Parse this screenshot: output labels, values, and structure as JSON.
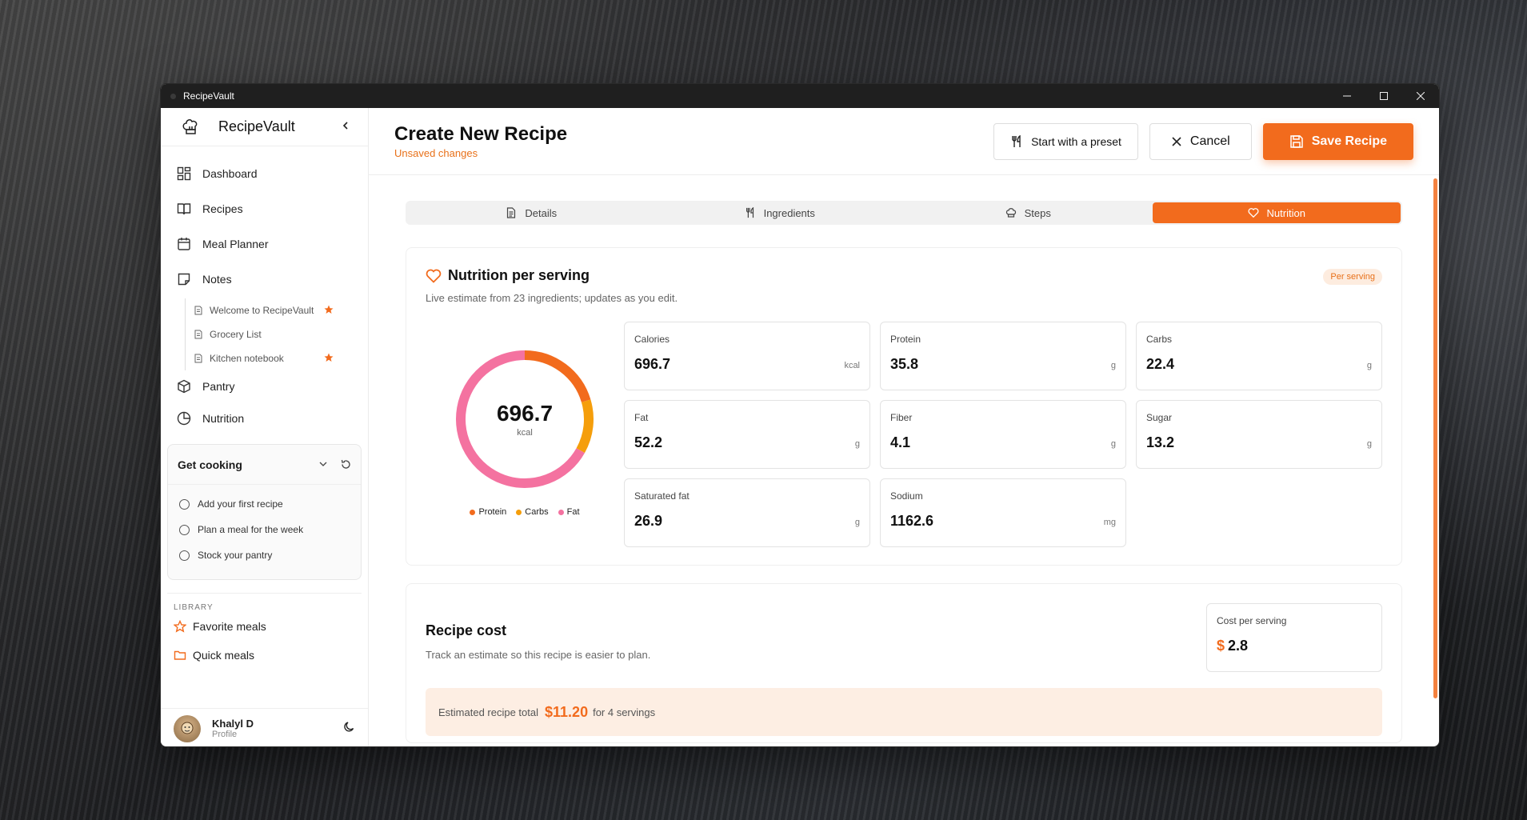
{
  "window": {
    "title": "RecipeVault"
  },
  "sidebar": {
    "brand": "RecipeVault",
    "nav": [
      {
        "label": "Dashboard",
        "icon": "grid-icon"
      },
      {
        "label": "Recipes",
        "icon": "book-icon"
      },
      {
        "label": "Meal Planner",
        "icon": "calendar-icon"
      },
      {
        "label": "Notes",
        "icon": "note-icon"
      }
    ],
    "notes": [
      {
        "label": "Welcome to RecipeVault",
        "starred": true
      },
      {
        "label": "Grocery List",
        "starred": false
      },
      {
        "label": "Kitchen notebook",
        "starred": true
      }
    ],
    "nav2": [
      {
        "label": "Pantry",
        "icon": "box-icon"
      },
      {
        "label": "Nutrition",
        "icon": "pie-icon"
      }
    ],
    "get_cooking": {
      "title": "Get cooking",
      "items": [
        "Add your first recipe",
        "Plan a meal for the week",
        "Stock your pantry"
      ]
    },
    "library": {
      "label": "LIBRARY",
      "items": [
        {
          "label": "Favorite meals",
          "icon": "star-icon"
        },
        {
          "label": "Quick meals",
          "icon": "folder-icon"
        }
      ]
    },
    "profile": {
      "name": "Khalyl D",
      "role": "Profile"
    }
  },
  "header": {
    "title": "Create New Recipe",
    "status": "Unsaved changes",
    "preset_label": "Start with a preset",
    "cancel_label": "Cancel",
    "save_label": "Save Recipe"
  },
  "tabs": [
    {
      "label": "Details",
      "active": false
    },
    {
      "label": "Ingredients",
      "active": false
    },
    {
      "label": "Steps",
      "active": false
    },
    {
      "label": "Nutrition",
      "active": true
    }
  ],
  "nutrition": {
    "title": "Nutrition per serving",
    "subtitle": "Live estimate from 23 ingredients; updates as you edit.",
    "badge": "Per serving",
    "donut": {
      "value": "696.7",
      "unit": "kcal",
      "legend": [
        "Protein",
        "Carbs",
        "Fat"
      ],
      "protein_g": 35.8,
      "carbs_g": 22.4,
      "fat_g": 52.2
    },
    "metrics": [
      {
        "label": "Calories",
        "value": "696.7",
        "unit": "kcal"
      },
      {
        "label": "Protein",
        "value": "35.8",
        "unit": "g"
      },
      {
        "label": "Carbs",
        "value": "22.4",
        "unit": "g"
      },
      {
        "label": "Fat",
        "value": "52.2",
        "unit": "g"
      },
      {
        "label": "Fiber",
        "value": "4.1",
        "unit": "g"
      },
      {
        "label": "Sugar",
        "value": "13.2",
        "unit": "g"
      },
      {
        "label": "Saturated fat",
        "value": "26.9",
        "unit": "g"
      },
      {
        "label": "Sodium",
        "value": "1162.6",
        "unit": "mg"
      }
    ]
  },
  "cost": {
    "title": "Recipe cost",
    "subtitle": "Track an estimate so this recipe is easier to plan.",
    "per_serving_label": "Cost per serving",
    "currency": "$",
    "per_serving_value": "2.8",
    "estimate_prefix": "Estimated recipe total",
    "estimate_amount": "$11.20",
    "estimate_suffix": "for 4 servings"
  },
  "colors": {
    "accent": "#f26b1d",
    "protein": "#f26b1d",
    "carbs": "#f59e0b",
    "fat": "#f472a0"
  }
}
